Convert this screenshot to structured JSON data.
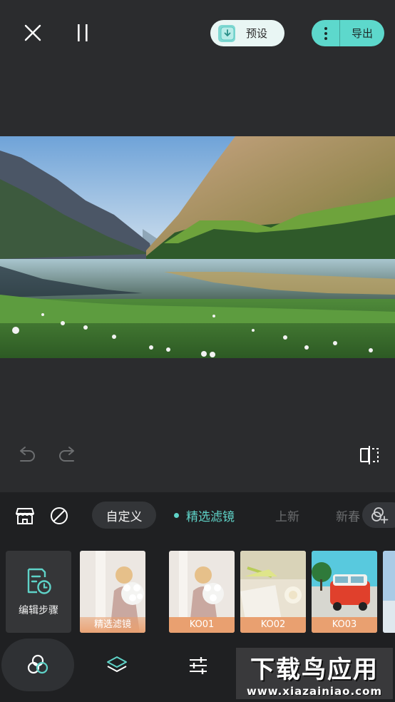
{
  "topbar": {
    "preset_label": "预设",
    "export_label": "导出"
  },
  "tabs": {
    "custom": "自定义",
    "featured": "精选滤镜",
    "new": "上新",
    "spring": "新春"
  },
  "strip": {
    "edit_steps_label": "编辑步骤",
    "thumbs": [
      {
        "caption": "精选滤镜"
      },
      {
        "caption": "KO01"
      },
      {
        "caption": "KO02"
      },
      {
        "caption": "KO03"
      }
    ]
  },
  "watermark": {
    "title": "下载鸟应用",
    "url": "www.xiazainiao.com"
  },
  "colors": {
    "accent": "#5dd8cc",
    "caption": "#e9a070",
    "background": "#2b2c2e",
    "panel": "#1f2022"
  },
  "icons": {
    "close": "close-icon",
    "pause": "pause-icon",
    "preset": "preset-download-icon",
    "more": "more-vertical-icon",
    "undo": "undo-icon",
    "redo": "redo-icon",
    "compare": "compare-icon",
    "store": "store-icon",
    "none": "no-filter-icon",
    "add_filter": "add-filter-icon",
    "edit_steps": "edit-steps-icon",
    "nav_filter": "filter-icon",
    "nav_layers": "layers-icon",
    "nav_adjust": "adjust-sliders-icon"
  }
}
